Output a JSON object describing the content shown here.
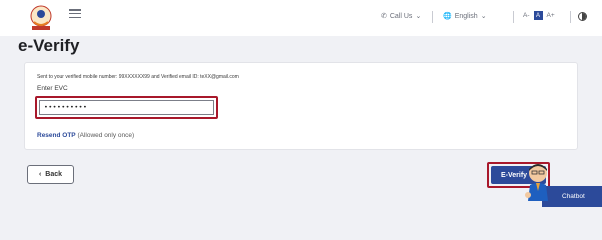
{
  "header": {
    "call_label": "Call Us",
    "language_label": "English",
    "font_small": "A-",
    "font_normal": "A",
    "font_large": "A+"
  },
  "page": {
    "title": "e-Verify"
  },
  "form": {
    "sent_message": "Sent to your verified mobile number: 99XXXXXX99 and Verified email ID: teXX@gmail.com",
    "evc_label": "Enter EVC",
    "evc_value": "••••••••••",
    "resend_link": "Resend OTP",
    "resend_note": " (Allowed only once)"
  },
  "actions": {
    "back_label": "Back",
    "everify_label": "E-Verify"
  },
  "chatbot": {
    "label": "Chatbot"
  },
  "colors": {
    "accent": "#2c4a9a",
    "highlight": "#a8182b"
  }
}
